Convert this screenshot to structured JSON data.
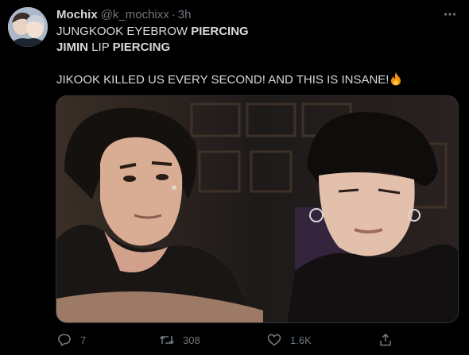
{
  "tweet": {
    "display_name": "Mochix",
    "handle": "@k_mochixx",
    "separator": "·",
    "time": "3h",
    "text": {
      "line1_a": "JUNGKOOK EYEBROW ",
      "line1_b": "PIERCING",
      "line2_a": "JIMIN",
      "line2_b": " LIP ",
      "line2_c": "PIERCING",
      "line3": "JIKOOK KILLED US EVERY SECOND! AND THIS IS INSANE!"
    },
    "emoji": "fire-emoji",
    "media_description_icon": "photo-media"
  },
  "actions": {
    "reply_count": "7",
    "retweet_count": "308",
    "like_count": "1.6K"
  },
  "icons": {
    "more": "more-icon",
    "reply": "reply-icon",
    "retweet": "retweet-icon",
    "like": "heart-icon",
    "share": "share-icon"
  },
  "colors": {
    "background": "#000000",
    "text": "#d9d9d9",
    "secondary": "#6e767d",
    "border": "#2f3336"
  }
}
